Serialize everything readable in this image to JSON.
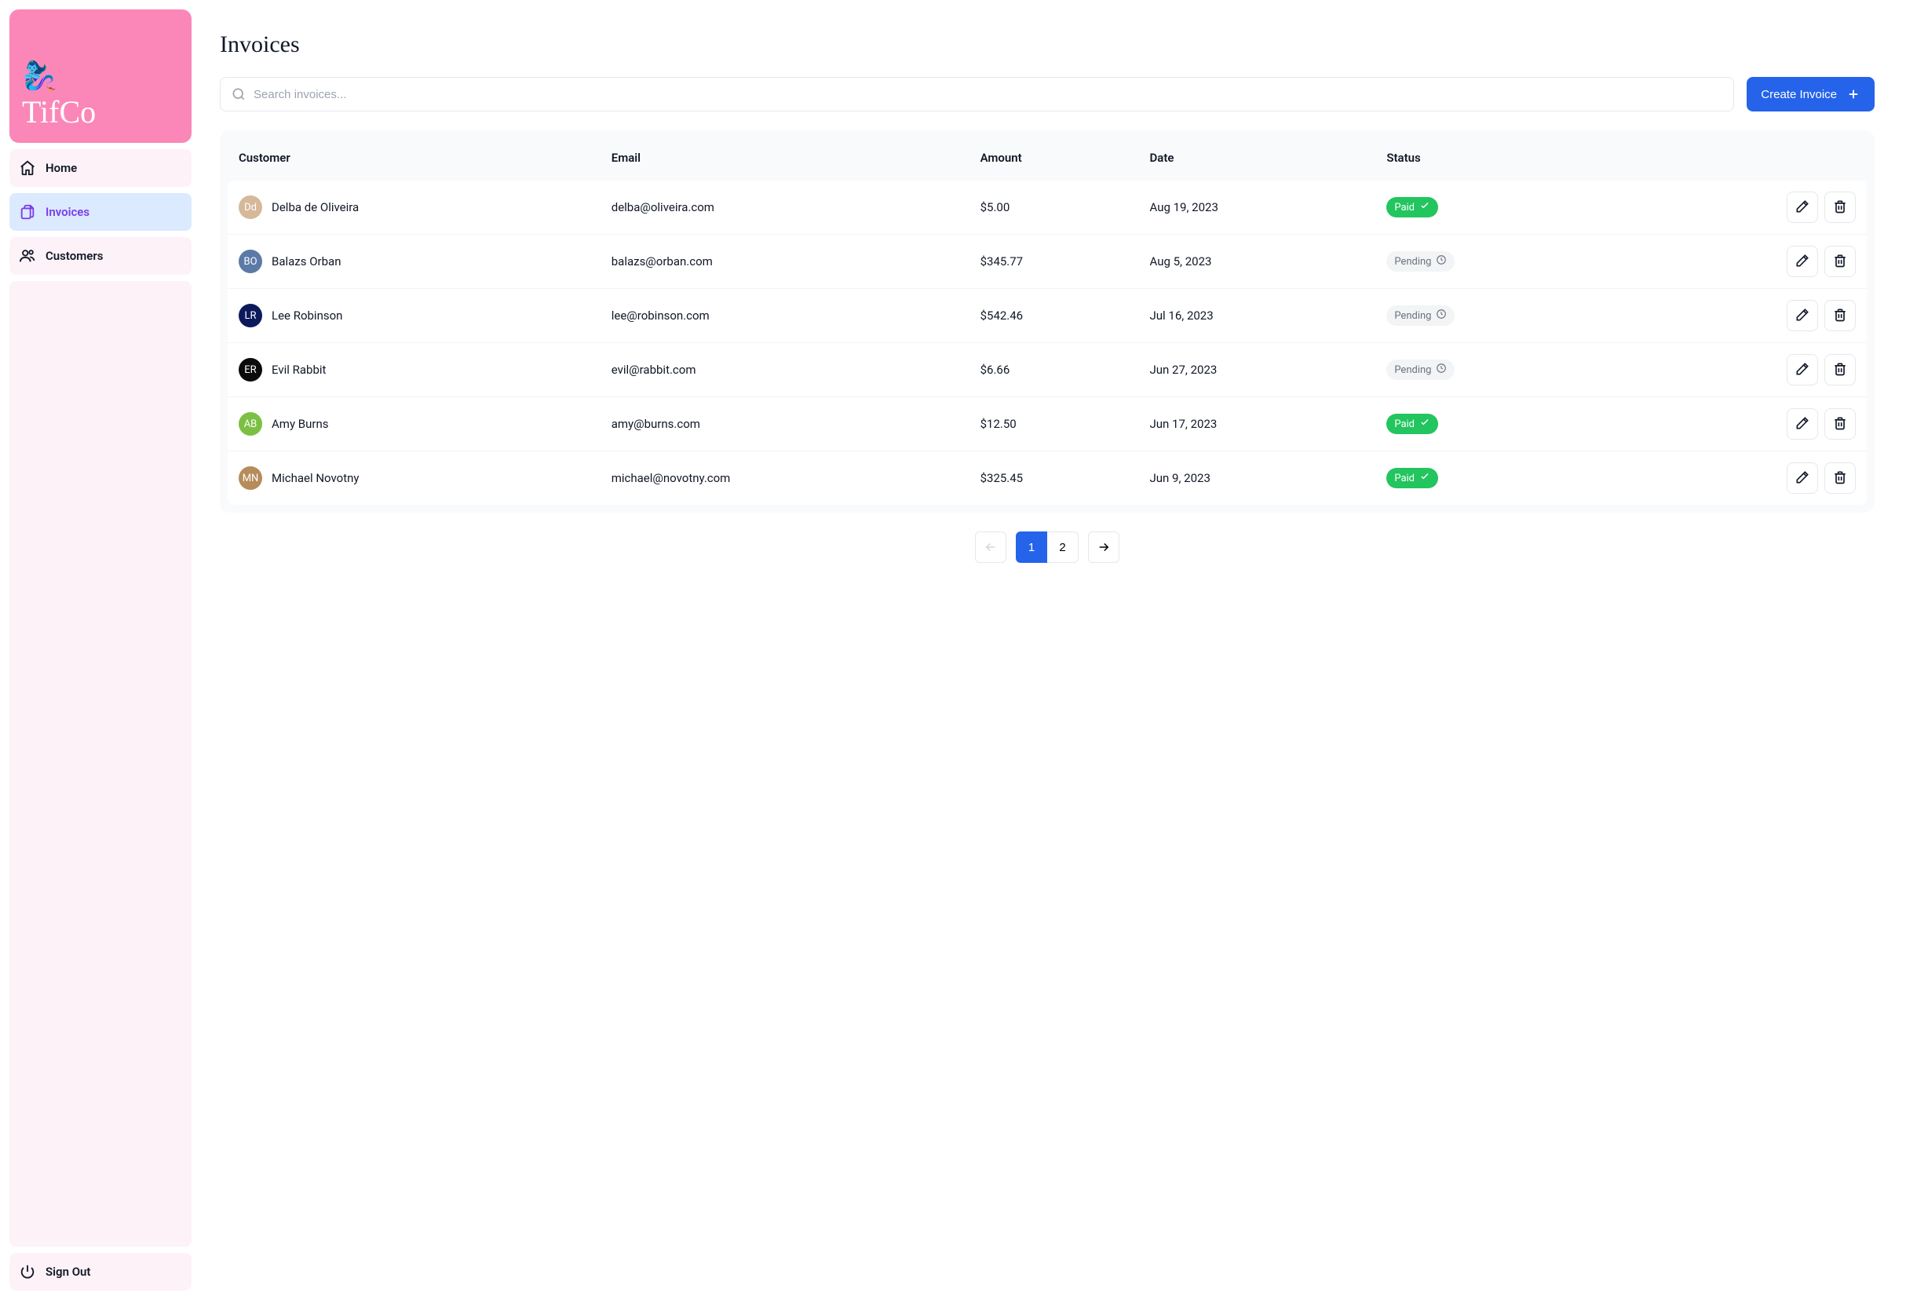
{
  "brand": {
    "name": "TifCo",
    "emoji": "🧞‍♀️"
  },
  "nav": {
    "home": "Home",
    "invoices": "Invoices",
    "customers": "Customers",
    "signout": "Sign Out"
  },
  "page": {
    "title": "Invoices"
  },
  "search": {
    "placeholder": "Search invoices..."
  },
  "create_button": "Create Invoice",
  "columns": {
    "customer": "Customer",
    "email": "Email",
    "amount": "Amount",
    "date": "Date",
    "status": "Status"
  },
  "status_labels": {
    "paid": "Paid",
    "pending": "Pending"
  },
  "rows": [
    {
      "name": "Delba de Oliveira",
      "email": "delba@oliveira.com",
      "amount": "$5.00",
      "date": "Aug 19, 2023",
      "status": "paid",
      "avatar_bg": "#d6b89a"
    },
    {
      "name": "Balazs Orban",
      "email": "balazs@orban.com",
      "amount": "$345.77",
      "date": "Aug 5, 2023",
      "status": "pending",
      "avatar_bg": "#5b7aa8"
    },
    {
      "name": "Lee Robinson",
      "email": "lee@robinson.com",
      "amount": "$542.46",
      "date": "Jul 16, 2023",
      "status": "pending",
      "avatar_bg": "#0c1a5c"
    },
    {
      "name": "Evil Rabbit",
      "email": "evil@rabbit.com",
      "amount": "$6.66",
      "date": "Jun 27, 2023",
      "status": "pending",
      "avatar_bg": "#0b0b0b"
    },
    {
      "name": "Amy Burns",
      "email": "amy@burns.com",
      "amount": "$12.50",
      "date": "Jun 17, 2023",
      "status": "paid",
      "avatar_bg": "#7bc043"
    },
    {
      "name": "Michael Novotny",
      "email": "michael@novotny.com",
      "amount": "$325.45",
      "date": "Jun 9, 2023",
      "status": "paid",
      "avatar_bg": "#b68c5a"
    }
  ],
  "pagination": {
    "current": 1,
    "pages": [
      1,
      2
    ]
  }
}
